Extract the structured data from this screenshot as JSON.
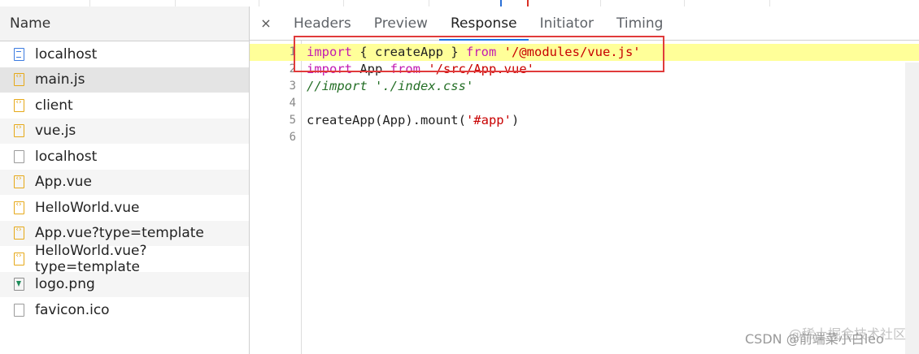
{
  "network": {
    "column_header": "Name",
    "files": [
      {
        "name": "localhost",
        "icon": "document-icon"
      },
      {
        "name": "main.js",
        "icon": "script-icon",
        "selected": true
      },
      {
        "name": "client",
        "icon": "script-icon"
      },
      {
        "name": "vue.js",
        "icon": "script-icon"
      },
      {
        "name": "localhost",
        "icon": "blank-file-icon"
      },
      {
        "name": "App.vue",
        "icon": "script-icon"
      },
      {
        "name": "HelloWorld.vue",
        "icon": "script-icon"
      },
      {
        "name": "App.vue?type=template",
        "icon": "script-icon"
      },
      {
        "name": "HelloWorld.vue?type=template",
        "icon": "script-icon"
      },
      {
        "name": "logo.png",
        "icon": "image-icon"
      },
      {
        "name": "favicon.ico",
        "icon": "blank-file-icon"
      }
    ]
  },
  "detail": {
    "close_symbol": "×",
    "tabs": [
      "Headers",
      "Preview",
      "Response",
      "Initiator",
      "Timing"
    ],
    "active_tab": "Response"
  },
  "response": {
    "lines": [
      {
        "num": "1",
        "highlight": true
      },
      {
        "num": "2"
      },
      {
        "num": "3"
      },
      {
        "num": "4"
      },
      {
        "num": "5"
      },
      {
        "num": "6"
      }
    ],
    "tokens": {
      "l1_kw1": "import",
      "l1_mid": " { createApp } ",
      "l1_kw2": "from",
      "l1_str": "'/@modules/vue.js'",
      "l2_kw1": "import",
      "l2_mid": " App ",
      "l2_kw2": "from",
      "l2_str": "'/src/App.vue'",
      "l3_cmt": "//import './index.css'",
      "l5_a": "createApp(App).mount(",
      "l5_str": "'#app'",
      "l5_b": ")"
    }
  },
  "watermark": {
    "text": "CSDN @前端菜小白leo",
    "overlay": "@稀土掘金技术社区"
  },
  "colors": {
    "highlight_line": "#ffff99",
    "annotation_box": "#e03b3b",
    "active_tab_underline": "#1a73e8",
    "keyword": "#c21bb2",
    "string": "#c80000",
    "comment": "#236e25"
  }
}
